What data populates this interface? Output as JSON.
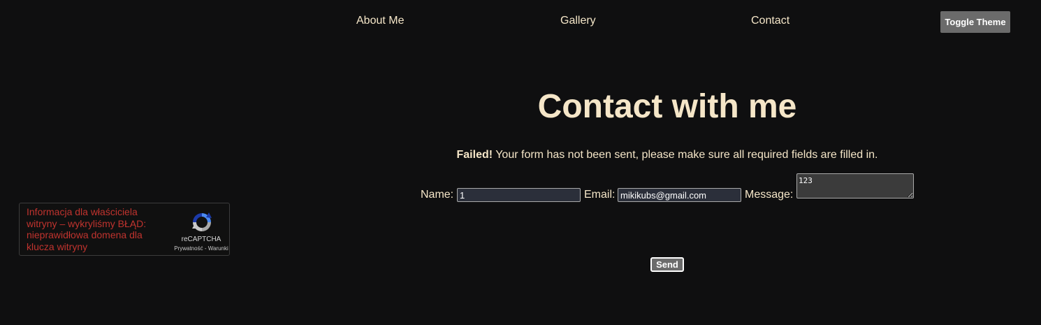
{
  "nav": {
    "items": [
      {
        "label": "About Me"
      },
      {
        "label": "Gallery"
      },
      {
        "label": "Contact"
      }
    ],
    "toggle_theme_label": "Toggle Theme"
  },
  "main": {
    "title": "Contact with me",
    "status": {
      "strong": "Failed!",
      "text": " Your form has not been sent, please make sure all required fields are filled in."
    },
    "form": {
      "name_label": "Name:",
      "name_value": "1",
      "email_label": "Email:",
      "email_value": "mikikubs@gmail.com",
      "message_label": "Message:",
      "message_value": "123",
      "send_label": "Send"
    }
  },
  "recaptcha": {
    "error_text": "Informacja dla właściciela witryny – wykryliśmy BŁĄD: nieprawidłowa domena dla klucza witryny",
    "brand": "reCAPTCHA",
    "privacy_label": "Prywatność",
    "separator": " - ",
    "terms_label": "Warunki"
  },
  "colors": {
    "background": "#0f0f10",
    "text": "#f5e6c8",
    "button": "#6b6b6b",
    "error": "#c0332e"
  }
}
